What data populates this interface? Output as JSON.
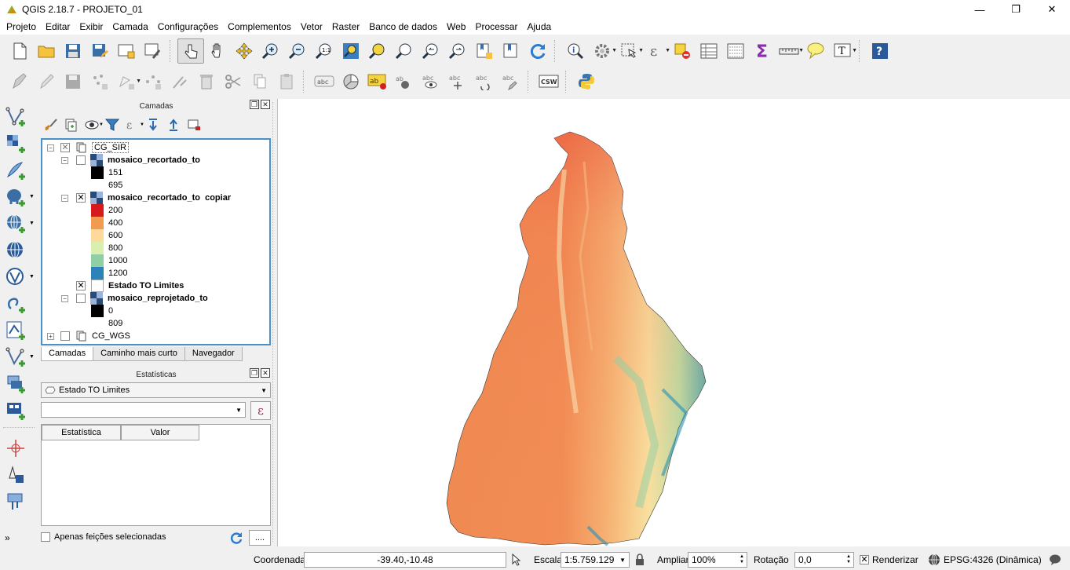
{
  "window": {
    "title": "QGIS 2.18.7 - PROJETO_01",
    "minimize": "—",
    "maximize": "❐",
    "close": "✕"
  },
  "menu": [
    "Projeto",
    "Editar",
    "Exibir",
    "Camada",
    "Configurações",
    "Complementos",
    "Vetor",
    "Raster",
    "Banco de dados",
    "Web",
    "Processar",
    "Ajuda"
  ],
  "layers_panel": {
    "title": "Camadas",
    "tree": {
      "group1": "CG_SIR",
      "layer1": {
        "name": "mosaico_recortado_to",
        "legend": [
          "151",
          "695"
        ]
      },
      "layer2": {
        "name": "mosaico_recortado_to  copiar",
        "legend": [
          "200",
          "400",
          "600",
          "800",
          "1000",
          "1200"
        ],
        "colors": [
          "#d7191c",
          "#f39a52",
          "#fdd99a",
          "#d9efb0",
          "#8ecfa6",
          "#2b83ba"
        ]
      },
      "layer3": {
        "name": "Estado TO Limites"
      },
      "layer4": {
        "name": "mosaico_reprojetado_to",
        "legend": [
          "0",
          "809"
        ]
      },
      "group2": "CG_WGS"
    }
  },
  "tabs": [
    "Camadas",
    "Caminho mais curto",
    "Navegador"
  ],
  "stats_panel": {
    "title": "Estatísticas",
    "layer_select": "Estado TO Limites",
    "field_select": "",
    "expr_button": "ε",
    "col_stat": "Estatística",
    "col_value": "Valor",
    "selected_only": "Apenas feições selecionadas",
    "more_button": "...."
  },
  "status": {
    "coord_label": "Coordenada",
    "coord_value": "-39.40,-10.48",
    "scale_label": "Escala",
    "scale_value": "1:5.759.129",
    "zoom_label": "Ampliar",
    "zoom_value": "100%",
    "rotation_label": "Rotação",
    "rotation_value": "0,0",
    "render_label": "Renderizar",
    "crs": "EPSG:4326 (Dinâmica)"
  },
  "colors": {
    "accent": "#4a90c9",
    "map_red": "#e8503a",
    "map_orange": "#f08a55",
    "map_yellow": "#f9e2a0",
    "map_green": "#a9d8a5",
    "map_teal": "#2b8fb0"
  }
}
